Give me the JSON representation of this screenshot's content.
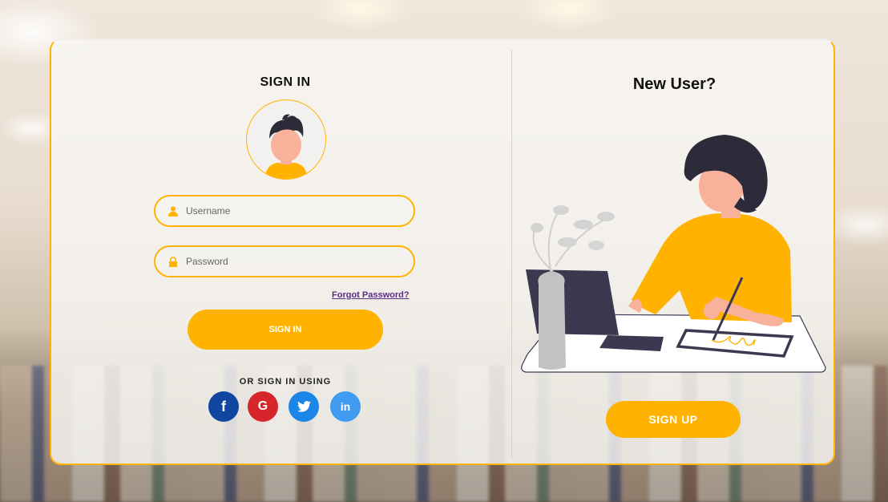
{
  "signin": {
    "title": "SIGN IN",
    "username_placeholder": "Username",
    "password_placeholder": "Password",
    "forgot_label": "Forgot Password?",
    "button_label": "SIGN IN",
    "alt_label": "OR SIGN IN USING"
  },
  "social": {
    "facebook_glyph": "f",
    "google_glyph": "G",
    "linkedin_glyph": "in"
  },
  "signup": {
    "title": "New User?",
    "button_label": "SIGN UP"
  },
  "colors": {
    "accent": "#ffb300",
    "facebook": "#1046a0",
    "google": "#d6262c",
    "twitter": "#1c86e8",
    "linkedin": "#3f9cf0",
    "link": "#5a2d82"
  }
}
